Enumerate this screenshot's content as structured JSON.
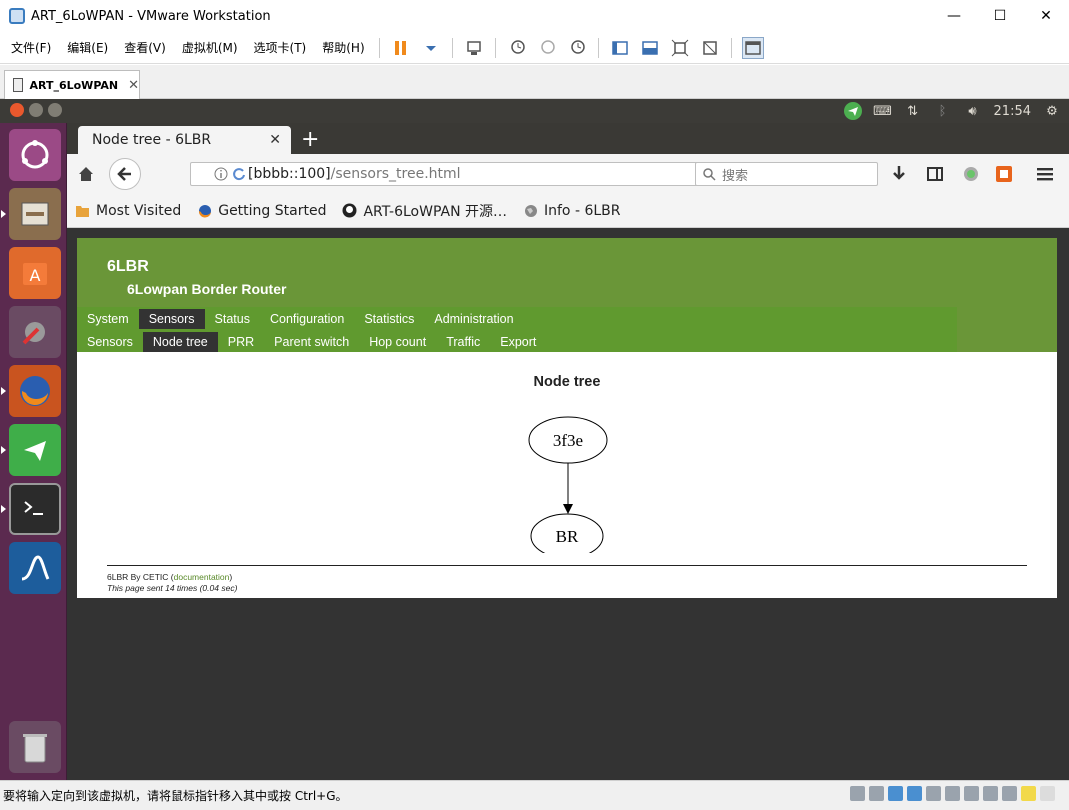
{
  "window": {
    "title": "ART_6LoWPAN - VMware Workstation",
    "minimize": "—",
    "maximize": "☐",
    "close": "✕"
  },
  "vm_menu": [
    "文件(F)",
    "编辑(E)",
    "查看(V)",
    "虚拟机(M)",
    "选项卡(T)",
    "帮助(H)"
  ],
  "vm_tab": {
    "label": "ART_6LoWPAN",
    "close": "✕"
  },
  "panel": {
    "time": "21:54"
  },
  "browser": {
    "tab_title": "Node tree - 6LBR",
    "tab_close": "✕",
    "new_tab": "+",
    "url_host": "[bbbb::100]",
    "url_path": "/sensors_tree.html",
    "search_placeholder": "搜索",
    "bookmarks": [
      "Most Visited",
      "Getting Started",
      "ART-6LoWPAN 开源…",
      "Info - 6LBR"
    ]
  },
  "page": {
    "brand": "6LBR",
    "brand_sub": "6Lowpan Border Router",
    "menu_primary": [
      "System",
      "Sensors",
      "Status",
      "Configuration",
      "Statistics",
      "Administration"
    ],
    "menu_primary_active": "Sensors",
    "menu_secondary": [
      "Sensors",
      "Node tree",
      "PRR",
      "Parent switch",
      "Hop count",
      "Traffic",
      "Export"
    ],
    "menu_secondary_active": "Node tree",
    "content_title": "Node tree",
    "graph": {
      "nodes": [
        "3f3e",
        "BR"
      ],
      "edges": [
        [
          "3f3e",
          "BR"
        ]
      ]
    },
    "footer_prefix": "6LBR By CETIC (",
    "footer_link": "documentation",
    "footer_suffix": ")",
    "footer_stats": "This page sent 14 times (0.04 sec)"
  },
  "status_bar": {
    "text": "要将输入定向到该虚拟机，请将鼠标指针移入其中或按 Ctrl+G。"
  }
}
